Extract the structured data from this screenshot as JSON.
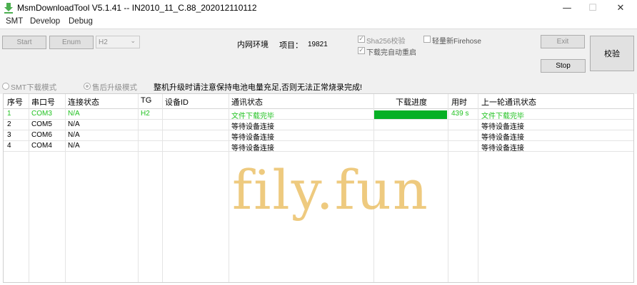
{
  "window": {
    "title": "MsmDownloadTool V5.1.41 -- IN2010_11_C.88_202012110112",
    "minimize_glyph": "—",
    "maximize_glyph": "☐",
    "close_glyph": "✕"
  },
  "menu": [
    "SMT",
    "Develop",
    "Debug"
  ],
  "toolbar": {
    "start_label": "Start",
    "enum_label": "Enum",
    "target_value": "H2",
    "network_label": "内网环境",
    "project_label": "项目：",
    "project_value": "19821",
    "sha256_label": "Sha256校验",
    "sha256_checked": true,
    "light_firehose_label": "轻量新Firehose",
    "light_firehose_checked": false,
    "auto_reboot_label": "下载完自动重启",
    "auto_reboot_checked": true,
    "exit_label": "Exit",
    "stop_label": "Stop",
    "verify_label": "校验",
    "smt_mode_label": "SMT下载模式",
    "aftersales_mode_label": "售后升级模式",
    "warning": "整机升级时请注意保持电池电量充足,否则无法正常烧录完成!"
  },
  "table": {
    "headers": [
      "序号",
      "串口号",
      "连接状态",
      "TG",
      "设备ID",
      "通讯状态",
      "下载进度",
      "用时",
      "上一轮通讯状态"
    ],
    "rows": [
      {
        "no": "1",
        "port": "COM3",
        "conn": "N/A",
        "tg": "H2",
        "device_id": "",
        "status": "文件下载完毕",
        "progress": 1.0,
        "time": "439 s",
        "last_status": "文件下载完毕",
        "done": true
      },
      {
        "no": "2",
        "port": "COM5",
        "conn": "N/A",
        "tg": "",
        "device_id": "",
        "status": "等待设备连接",
        "progress": 0,
        "time": "",
        "last_status": "等待设备连接",
        "done": false
      },
      {
        "no": "3",
        "port": "COM6",
        "conn": "N/A",
        "tg": "",
        "device_id": "",
        "status": "等待设备连接",
        "progress": 0,
        "time": "",
        "last_status": "等待设备连接",
        "done": false
      },
      {
        "no": "4",
        "port": "COM4",
        "conn": "N/A",
        "tg": "",
        "device_id": "",
        "status": "等待设备连接",
        "progress": 0,
        "time": "",
        "last_status": "等待设备连接",
        "done": false
      }
    ]
  },
  "watermark": "fily.fun",
  "colors": {
    "done_text": "#22c222",
    "progress_fill": "#06b025",
    "watermark": "#e8b54a"
  }
}
